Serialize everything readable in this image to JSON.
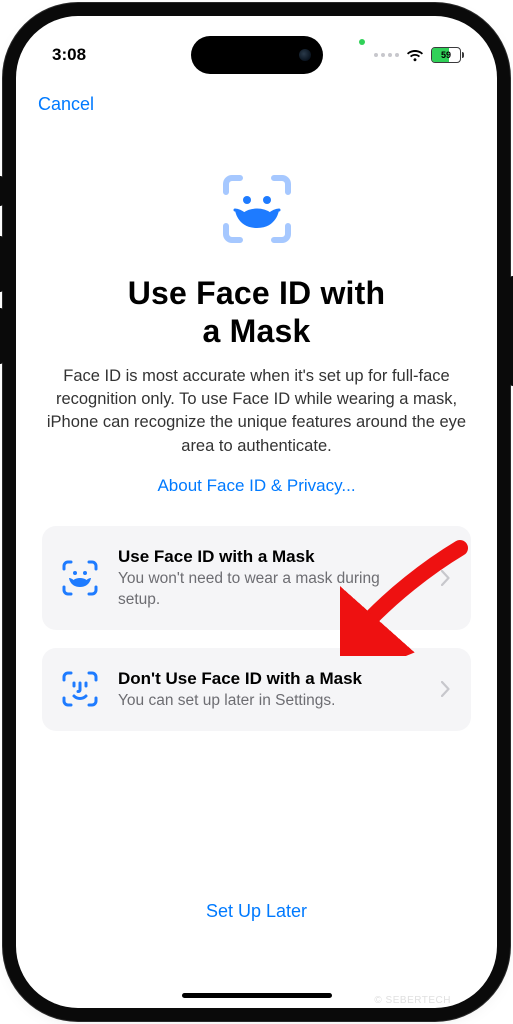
{
  "status": {
    "time": "3:08",
    "battery_pct": "59"
  },
  "nav": {
    "cancel": "Cancel"
  },
  "hero": {
    "title_line1": "Use Face ID with",
    "title_line2": "a Mask",
    "description": "Face ID is most accurate when it's set up for full-face recognition only. To use Face ID while wearing a mask, iPhone can recognize the unique features around the eye area to authenticate.",
    "about_link": "About Face ID & Privacy..."
  },
  "options": [
    {
      "title": "Use Face ID with a Mask",
      "subtitle": "You won't need to wear a mask during setup."
    },
    {
      "title": "Don't Use Face ID with a Mask",
      "subtitle": "You can set up later in Settings."
    }
  ],
  "footer": {
    "setup_later": "Set Up Later"
  },
  "watermark": "© SEBERTECH"
}
